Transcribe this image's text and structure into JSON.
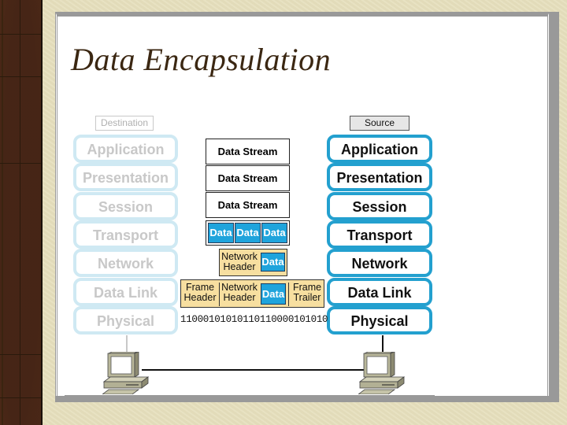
{
  "slide": {
    "title": "Data Encapsulation"
  },
  "destination": {
    "label": "Destination",
    "layers": [
      "Application",
      "Presentation",
      "Session",
      "Transport",
      "Network",
      "Data Link",
      "Physical"
    ]
  },
  "source": {
    "label": "Source",
    "layers": [
      "Application",
      "Presentation",
      "Session",
      "Transport",
      "Network",
      "Data Link",
      "Physical"
    ]
  },
  "pdus": {
    "data_stream": [
      "Data Stream",
      "Data Stream",
      "Data Stream"
    ],
    "segments": [
      "Data",
      "Data",
      "Data"
    ],
    "packet": {
      "header_line1": "Network",
      "header_line2": "Header",
      "data": "Data"
    },
    "frame": {
      "frame_header_line1": "Frame",
      "frame_header_line2": "Header",
      "network_header_line1": "Network",
      "network_header_line2": "Header",
      "data": "Data",
      "trailer_line1": "Frame",
      "trailer_line2": "Trailer"
    },
    "bits": "11000101010110110000101010"
  },
  "colors": {
    "source_layer_border": "#23a0cf",
    "destination_layer_border": "#cfe9f3",
    "data_fill": "#1fa4dc",
    "header_fill": "#f7dfa0",
    "title_color": "#3b2712"
  }
}
